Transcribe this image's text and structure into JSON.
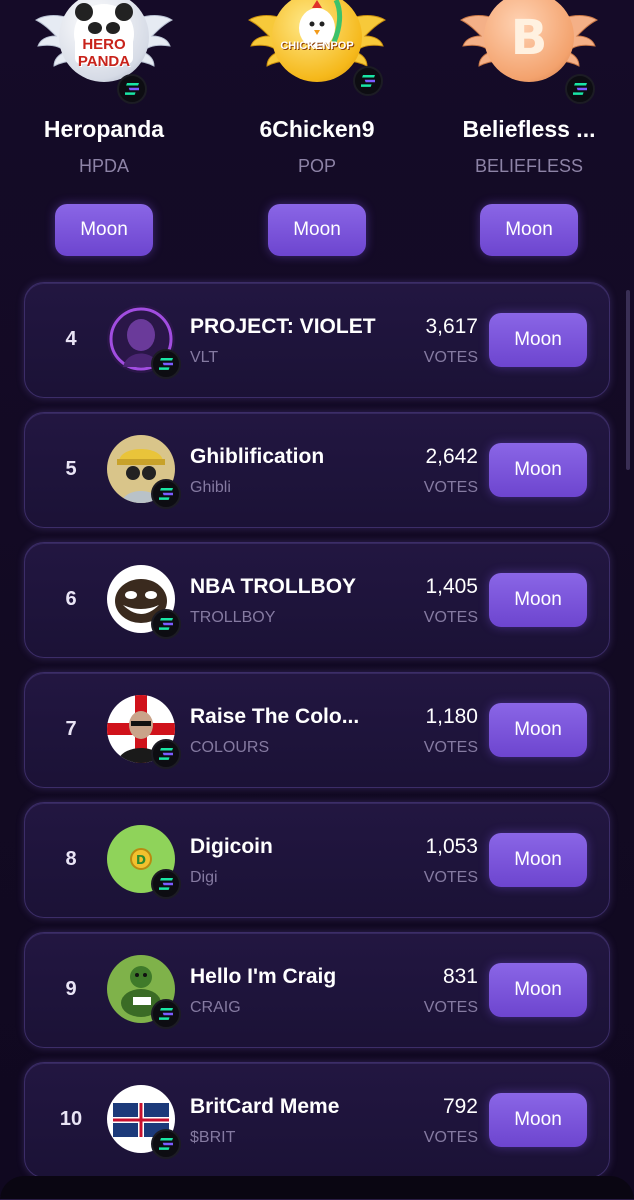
{
  "podium": [
    {
      "name": "Heropanda",
      "ticker": "HPDA",
      "button": "Moon",
      "medal": "silver",
      "logo_text": "HERO PANDA",
      "chain": "solana-icon"
    },
    {
      "name": "6Chicken9",
      "ticker": "POP",
      "button": "Moon",
      "medal": "gold",
      "logo_text": "CHICKENPOP",
      "chain": "solana-icon"
    },
    {
      "name": "Beliefless ...",
      "ticker": "BELIEFLESS",
      "button": "Moon",
      "medal": "bronze",
      "logo_text": "B",
      "chain": "solana-icon"
    }
  ],
  "list": [
    {
      "rank": "4",
      "name": "PROJECT: VIOLET",
      "ticker": "VLT",
      "votes": "3,617",
      "votes_label": "VOTES",
      "button": "Moon",
      "avatar_color": "#3b1f5e"
    },
    {
      "rank": "5",
      "name": "Ghiblification",
      "ticker": "Ghibli",
      "votes": "2,642",
      "votes_label": "VOTES",
      "button": "Moon",
      "avatar_color": "#d9c58a"
    },
    {
      "rank": "6",
      "name": "NBA TROLLBOY",
      "ticker": "TROLLBOY",
      "votes": "1,405",
      "votes_label": "VOTES",
      "button": "Moon",
      "avatar_color": "#ffffff"
    },
    {
      "rank": "7",
      "name": "Raise The Colo...",
      "ticker": "COLOURS",
      "votes": "1,180",
      "votes_label": "VOTES",
      "button": "Moon",
      "avatar_color": "#e8e8e8"
    },
    {
      "rank": "8",
      "name": "Digicoin",
      "ticker": "Digi",
      "votes": "1,053",
      "votes_label": "VOTES",
      "button": "Moon",
      "avatar_color": "#8fd35a"
    },
    {
      "rank": "9",
      "name": "Hello I'm Craig",
      "ticker": "CRAIG",
      "votes": "831",
      "votes_label": "VOTES",
      "button": "Moon",
      "avatar_color": "#7fb24a"
    },
    {
      "rank": "10",
      "name": "BritCard Meme",
      "ticker": "$BRIT",
      "votes": "792",
      "votes_label": "VOTES",
      "button": "Moon",
      "avatar_color": "#1c3a7a"
    }
  ],
  "colors": {
    "accent": "#7b56dc",
    "card_bg": "#1f153b",
    "text_muted": "#857aa1"
  }
}
